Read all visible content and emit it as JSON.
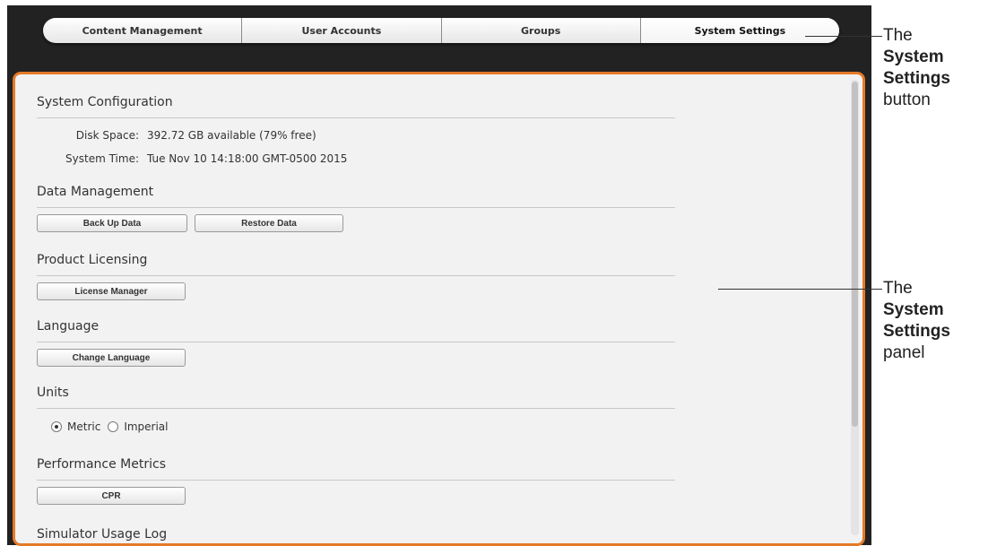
{
  "tabs": [
    {
      "label": "Content Management"
    },
    {
      "label": "User Accounts"
    },
    {
      "label": "Groups"
    },
    {
      "label": "System Settings",
      "active": true
    }
  ],
  "panel": {
    "system_configuration": {
      "title": "System Configuration",
      "disk_space_label": "Disk Space:",
      "disk_space_value": "392.72 GB available (79% free)",
      "system_time_label": "System Time:",
      "system_time_value": "Tue Nov 10 14:18:00 GMT-0500 2015"
    },
    "data_management": {
      "title": "Data Management",
      "backup_label": "Back Up Data",
      "restore_label": "Restore Data"
    },
    "product_licensing": {
      "title": "Product Licensing",
      "license_manager_label": "License Manager"
    },
    "language": {
      "title": "Language",
      "change_language_label": "Change Language"
    },
    "units": {
      "title": "Units",
      "options": [
        "Metric",
        "Imperial"
      ],
      "selected": "Metric"
    },
    "performance_metrics": {
      "title": "Performance Metrics",
      "cpr_label": "CPR"
    },
    "simulator_usage_log": {
      "title": "Simulator Usage Log"
    }
  },
  "callouts": {
    "button": {
      "prefix": "The",
      "bold1": "System",
      "bold2": "Settings",
      "suffix": "button"
    },
    "panel": {
      "prefix": "The",
      "bold1": "System",
      "bold2": "Settings",
      "suffix": "panel"
    }
  },
  "colors": {
    "frame": "#222222",
    "panel_border": "#e57a28",
    "panel_background": "#f2f2f2"
  }
}
